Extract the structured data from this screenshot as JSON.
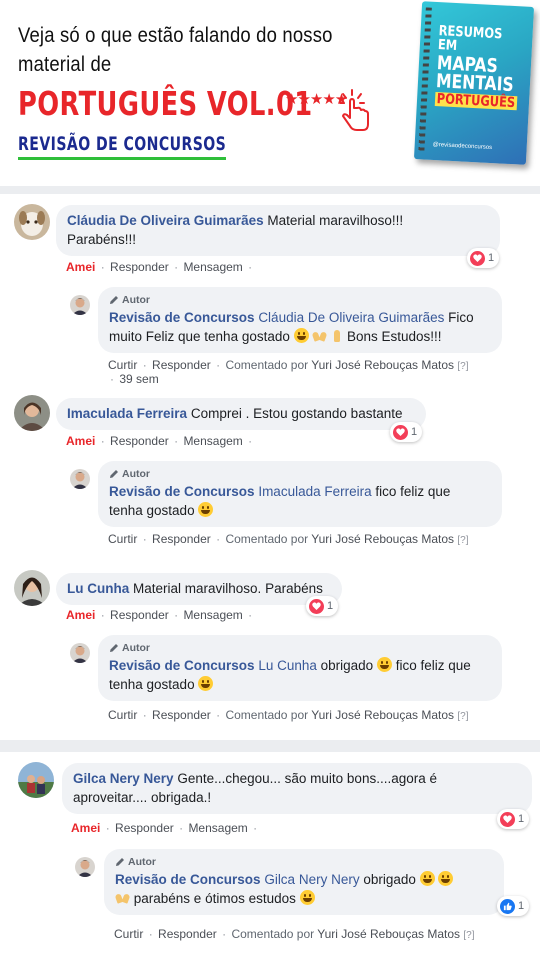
{
  "header": {
    "line1": "Veja só o que estão falando do nosso",
    "line2": "material de",
    "title": "PORTUGUÊS VOL.01",
    "subtitle": "REVISÃO DE CONCURSOS",
    "stars": "★★★★★",
    "book": {
      "t1": "RESUMOS",
      "t2": "EM",
      "t3": "MAPAS",
      "t4": "MENTAIS",
      "t5": "PORTUGUÊS",
      "handle": "@revisaodeconcursos"
    }
  },
  "ui": {
    "amei": "Amei",
    "responder": "Responder",
    "mensagem": "Mensagem",
    "curtir": "Curtir",
    "comentado_por": "Comentado por",
    "moderator": "Yuri José Rebouças Matos",
    "help": "[?]",
    "sep": "·",
    "author_badge": "Autor",
    "page_name": "Revisão de Concursos"
  },
  "comments": [
    {
      "name": "Cláudia De Oliveira Guimarães",
      "text1": "Material maravilhoso!!!",
      "text2": "Parabéns!!!",
      "reaction_count": "1",
      "reply": {
        "mention": "Cláudia De Oliveira Guimarães",
        "text_a": "Fico",
        "text_b": "muito Feliz que tenha gostado",
        "text_c": "Bons Estudos!!!"
      },
      "time": "39 sem"
    },
    {
      "name": "Imaculada Ferreira",
      "text1": "Comprei . Estou gostando bastante",
      "reaction_count": "1",
      "reply": {
        "mention": "Imaculada Ferreira",
        "text_a": "fico feliz que",
        "text_b": "tenha gostado"
      }
    },
    {
      "name": "Lu Cunha",
      "text1": "Material maravilhoso. Parabéns",
      "reaction_count": "1",
      "reply": {
        "mention": "Lu Cunha",
        "text_a": "obrigado",
        "text_a2": "fico feliz que",
        "text_b": "tenha gostado"
      }
    },
    {
      "name": "Gilca Nery Nery",
      "text1": "Gente...chegou... são muito bons....agora é",
      "text2": "aproveitar.... obrigada.!",
      "reaction_count": "1",
      "reply": {
        "mention": "Gilca Nery Nery",
        "text_a": "obrigado",
        "text_b": "parabéns e ótimos estudos",
        "reaction_count": "1"
      }
    }
  ],
  "colors": {
    "accent_red": "#e8262a",
    "navy": "#1b2a8f",
    "green": "#2fbf3a",
    "fb_link": "#385898",
    "love": "#f33e58",
    "like": "#1877f2"
  }
}
